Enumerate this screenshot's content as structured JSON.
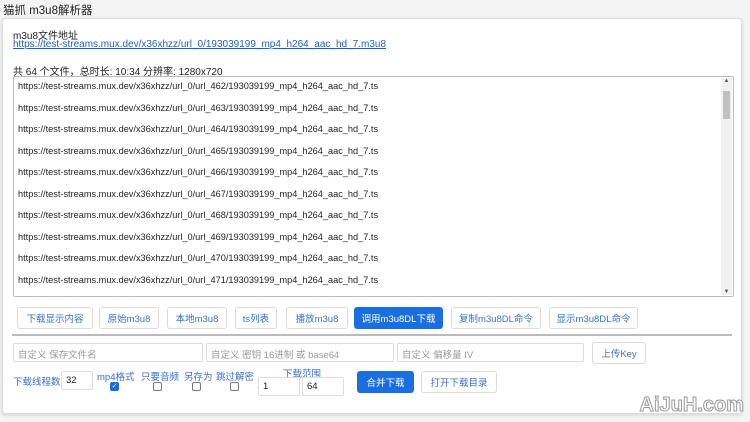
{
  "window": {
    "title": "猫抓 m3u8解析器"
  },
  "source": {
    "label": "m3u8文件地址",
    "url": "https://test-streams.mux.dev/x36xhzz/url_0/193039199_mp4_h264_aac_hd_7.m3u8"
  },
  "summary": "共 64 个文件，总时长: 10:34 分辨率: 1280x720",
  "ts_list": [
    "https://test-streams.mux.dev/x36xhzz/url_0/url_462/193039199_mp4_h264_aac_hd_7.ts",
    "https://test-streams.mux.dev/x36xhzz/url_0/url_463/193039199_mp4_h264_aac_hd_7.ts",
    "https://test-streams.mux.dev/x36xhzz/url_0/url_464/193039199_mp4_h264_aac_hd_7.ts",
    "https://test-streams.mux.dev/x36xhzz/url_0/url_465/193039199_mp4_h264_aac_hd_7.ts",
    "https://test-streams.mux.dev/x36xhzz/url_0/url_466/193039199_mp4_h264_aac_hd_7.ts",
    "https://test-streams.mux.dev/x36xhzz/url_0/url_467/193039199_mp4_h264_aac_hd_7.ts",
    "https://test-streams.mux.dev/x36xhzz/url_0/url_468/193039199_mp4_h264_aac_hd_7.ts",
    "https://test-streams.mux.dev/x36xhzz/url_0/url_469/193039199_mp4_h264_aac_hd_7.ts",
    "https://test-streams.mux.dev/x36xhzz/url_0/url_470/193039199_mp4_h264_aac_hd_7.ts",
    "https://test-streams.mux.dev/x36xhzz/url_0/url_471/193039199_mp4_h264_aac_hd_7.ts"
  ],
  "buttons": [
    "下载显示内容",
    "原始m3u8",
    "本地m3u8",
    "ts列表",
    "播放m3u8",
    "调用m3u8DL下载",
    "复制m3u8DL命令",
    "显示m3u8DL命令"
  ],
  "inputs": {
    "filename_placeholder": "自定义 保存文件名",
    "key_placeholder": "自定义 密钥 16进制 或 base64",
    "iv_placeholder": "自定义 偏移量 IV",
    "upload_key": "上传Key"
  },
  "options": {
    "threads_label": "下载线程数",
    "threads": "32",
    "mp4_label": "mp4格式",
    "mp4": true,
    "audio_label": "只要音频",
    "audio": false,
    "saveas_label": "另存为",
    "saveas": false,
    "skipdec_label": "跳过解密",
    "skipdec": false,
    "range_label": "下载范围",
    "range_start": "1",
    "range_end": "64",
    "merge": "合并下载",
    "open_dir": "打开下载目录"
  },
  "watermark": "AiJuH.com",
  "colors": {
    "accent": "#1a6fe0",
    "link": "#1a5fd0"
  }
}
